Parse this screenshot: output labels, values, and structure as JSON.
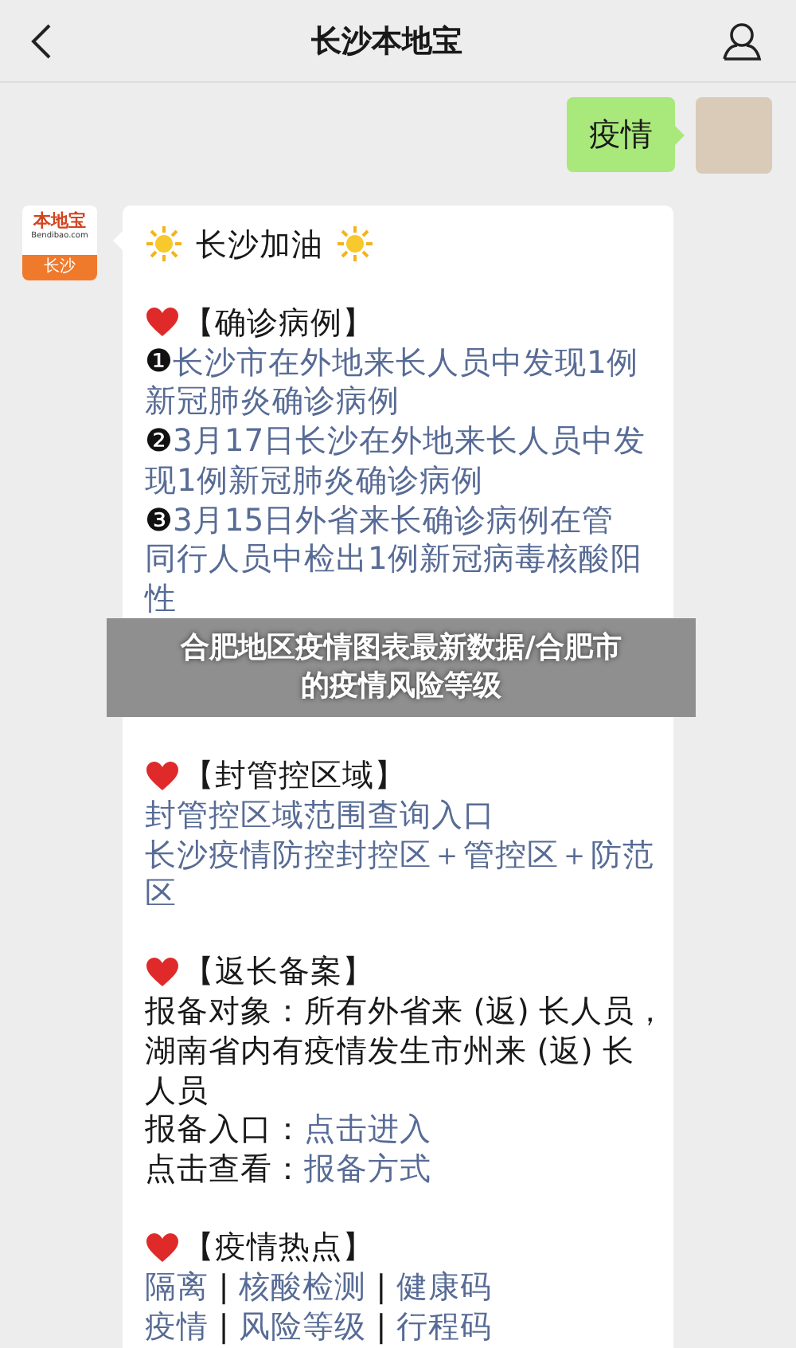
{
  "header": {
    "title": "长沙本地宝"
  },
  "messages": [
    {
      "kind": "outgoing",
      "text": "疫情"
    },
    {
      "kind": "incoming",
      "logo": {
        "brand": "本地宝",
        "domain": "Bendibao.com",
        "city": "长沙"
      },
      "title": "长沙加油",
      "sections": [
        {
          "heading": "【确诊病例】",
          "lines": [
            [
              {
                "kind": "number",
                "text": "❶"
              },
              {
                "kind": "link",
                "text": "长沙市在外地来长人员中发现1例"
              }
            ],
            [
              {
                "kind": "link",
                "text": "新冠肺炎确诊病例"
              }
            ],
            [
              {
                "kind": "number",
                "text": "❷"
              },
              {
                "kind": "link",
                "text": "3月17日长沙在外地来长人员中发"
              }
            ],
            [
              {
                "kind": "link",
                "text": "现1例新冠肺炎确诊病例"
              }
            ],
            [
              {
                "kind": "number",
                "text": "❸"
              },
              {
                "kind": "link",
                "text": "3月15日外省来长确诊病例在管"
              }
            ],
            [
              {
                "kind": "link",
                "text": "同行人员中检出1例新冠病毒核酸阳"
              }
            ],
            [
              {
                "kind": "link",
                "text": "性"
              }
            ]
          ],
          "banner": [
            "合肥地区疫情图表最新数据/合肥市",
            "的疫情风险等级"
          ]
        },
        {
          "heading": "【封管控区域】",
          "lines": [
            [
              {
                "kind": "link",
                "text": "封管控区域范围查询入口"
              }
            ],
            [
              {
                "kind": "link",
                "text": "长沙疫情防控封控区＋管控区＋防范"
              }
            ],
            [
              {
                "kind": "link",
                "text": "区"
              }
            ]
          ]
        },
        {
          "heading": "【返长备案】",
          "lines": [
            [
              {
                "kind": "plain",
                "text": "报备对象：所有外省来 (返) 长人员，"
              }
            ],
            [
              {
                "kind": "plain",
                "text": "湖南省内有疫情发生市州来 (返) 长"
              }
            ],
            [
              {
                "kind": "plain",
                "text": "人员"
              }
            ],
            [
              {
                "kind": "plain",
                "text": "报备入口："
              },
              {
                "kind": "link",
                "text": "点击进入"
              }
            ],
            [
              {
                "kind": "plain",
                "text": "点击查看："
              },
              {
                "kind": "link",
                "text": "报备方式"
              }
            ]
          ]
        },
        {
          "heading": "【疫情热点】",
          "lines": [
            [
              {
                "kind": "link",
                "text": "隔离"
              },
              {
                "kind": "plain",
                "text": " | "
              },
              {
                "kind": "link",
                "text": "核酸检测"
              },
              {
                "kind": "plain",
                "text": " | "
              },
              {
                "kind": "link",
                "text": "健康码"
              }
            ],
            [
              {
                "kind": "link",
                "text": "疫情"
              },
              {
                "kind": "plain",
                "text": " | "
              },
              {
                "kind": "link",
                "text": "风险等级"
              },
              {
                "kind": "plain",
                "text": " | "
              },
              {
                "kind": "link",
                "text": "行程码"
              }
            ]
          ]
        }
      ]
    }
  ]
}
